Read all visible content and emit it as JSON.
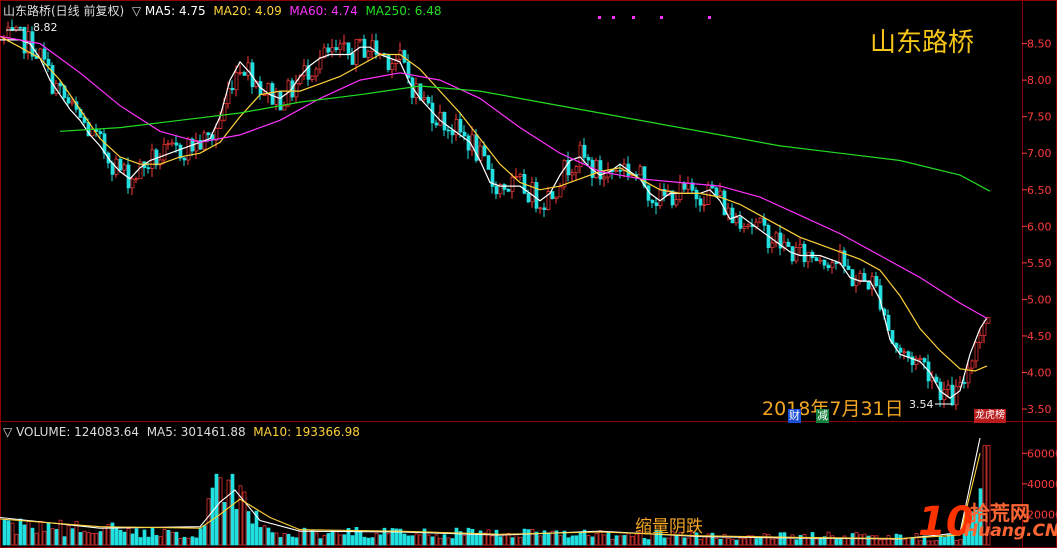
{
  "header": {
    "price_title": "山东路桥(日线 前复权)",
    "ma5_label": "MA5: 4.75",
    "ma20_label": "MA20: 4.09",
    "ma60_label": "MA60: 4.74",
    "ma250_label": "MA250: 6.48",
    "volume_title": "VOLUME: 124083.64",
    "vol_ma5_label": "MA5: 301461.88",
    "vol_ma10_label": "MA10: 193366.98"
  },
  "stock_name": "山东路桥",
  "annotations": {
    "date_label": "2018年7月31日",
    "high_label": "8.82",
    "low_label": "3.54",
    "volume_note": "缩量阴跌",
    "event_markers": [
      "财",
      "减",
      "龙虎榜"
    ]
  },
  "logo": {
    "number": "10",
    "text_top": "拾荒网",
    "text_bottom": "Huang.CN"
  },
  "colors": {
    "up": "#ff3b3b",
    "down": "#22e0e0",
    "ma5": "#ffffff",
    "ma20": "#ffd23a",
    "ma60": "#ff33ff",
    "ma250": "#22dd22",
    "grid": "#8b0000",
    "axis_text": "#ff3b3b"
  },
  "chart_data": [
    {
      "type": "line",
      "title": "山东路桥(日线 前复权)",
      "price_axis_ticks": [
        3.5,
        4.0,
        4.5,
        5.0,
        5.5,
        6.0,
        6.5,
        7.0,
        7.5,
        8.0,
        8.5
      ],
      "ylim": [
        3.35,
        8.85
      ],
      "series": [
        {
          "name": "MA5",
          "x": [
            0,
            10,
            20,
            30,
            40,
            50,
            60,
            70,
            80,
            90,
            100,
            110,
            120,
            130,
            140,
            150,
            160,
            170,
            180,
            190,
            200,
            210,
            220,
            230,
            240,
            250,
            260,
            270,
            280,
            290,
            300,
            310,
            320,
            330,
            340,
            350,
            360,
            370,
            380,
            390,
            400,
            410,
            420,
            430,
            440,
            450,
            460,
            470,
            480,
            490,
            500,
            510,
            520,
            530,
            540,
            550,
            560,
            570,
            580,
            590,
            600,
            610,
            620,
            630,
            640,
            650,
            660,
            670,
            680,
            690,
            700,
            710,
            720,
            730,
            740,
            750,
            760,
            770,
            780,
            790,
            800,
            810,
            820,
            830,
            840,
            850,
            860,
            870,
            880,
            890,
            900,
            910,
            920,
            930,
            940,
            950,
            960,
            970,
            980,
            987
          ],
          "values": [
            8.55,
            8.55,
            8.55,
            8.5,
            8.3,
            8.0,
            7.8,
            7.6,
            7.45,
            7.25,
            7.1,
            6.9,
            6.75,
            6.65,
            6.8,
            6.9,
            6.95,
            7.0,
            7.05,
            7.1,
            7.15,
            7.2,
            7.5,
            8.0,
            8.25,
            8.1,
            7.9,
            7.8,
            7.75,
            7.85,
            8.05,
            8.2,
            8.3,
            8.35,
            8.35,
            8.35,
            8.45,
            8.45,
            8.35,
            8.3,
            8.25,
            7.95,
            7.75,
            7.6,
            7.45,
            7.35,
            7.25,
            7.15,
            6.9,
            6.6,
            6.55,
            6.55,
            6.55,
            6.45,
            6.35,
            6.45,
            6.7,
            6.9,
            6.95,
            6.8,
            6.7,
            6.75,
            6.85,
            6.75,
            6.65,
            6.45,
            6.35,
            6.45,
            6.45,
            6.45,
            6.45,
            6.5,
            6.35,
            6.1,
            6.15,
            6.05,
            5.95,
            5.85,
            5.75,
            5.65,
            5.6,
            5.6,
            5.6,
            5.55,
            5.5,
            5.3,
            5.25,
            5.25,
            5.0,
            4.45,
            4.25,
            4.2,
            4.15,
            4.0,
            3.75,
            3.65,
            3.75,
            4.25,
            4.6,
            4.75
          ]
        },
        {
          "name": "MA20",
          "x": [
            0,
            20,
            40,
            60,
            80,
            100,
            120,
            140,
            160,
            180,
            200,
            220,
            240,
            260,
            280,
            300,
            320,
            340,
            360,
            380,
            400,
            420,
            440,
            460,
            480,
            500,
            520,
            540,
            560,
            580,
            600,
            620,
            640,
            660,
            680,
            700,
            720,
            740,
            760,
            780,
            800,
            820,
            840,
            860,
            880,
            900,
            920,
            940,
            960,
            975,
            987
          ],
          "values": [
            8.6,
            8.45,
            8.3,
            8.0,
            7.6,
            7.2,
            6.95,
            6.85,
            6.85,
            6.95,
            7.0,
            7.15,
            7.5,
            7.8,
            7.85,
            7.85,
            7.95,
            8.05,
            8.2,
            8.35,
            8.35,
            8.15,
            7.85,
            7.55,
            7.2,
            6.85,
            6.6,
            6.5,
            6.55,
            6.65,
            6.75,
            6.8,
            6.65,
            6.5,
            6.45,
            6.45,
            6.4,
            6.3,
            6.15,
            6.0,
            5.85,
            5.75,
            5.65,
            5.55,
            5.4,
            5.05,
            4.6,
            4.3,
            4.05,
            4.02,
            4.09
          ]
        },
        {
          "name": "MA60",
          "x": [
            0,
            40,
            80,
            120,
            160,
            200,
            240,
            280,
            320,
            360,
            400,
            440,
            480,
            520,
            560,
            600,
            640,
            680,
            720,
            760,
            800,
            840,
            880,
            920,
            960,
            987
          ],
          "values": [
            8.6,
            8.5,
            8.1,
            7.65,
            7.3,
            7.15,
            7.25,
            7.45,
            7.75,
            8.0,
            8.1,
            8.0,
            7.75,
            7.35,
            7.0,
            6.75,
            6.65,
            6.6,
            6.55,
            6.4,
            6.15,
            5.9,
            5.6,
            5.3,
            4.95,
            4.74
          ]
        },
        {
          "name": "MA250",
          "x": [
            60,
            120,
            180,
            240,
            300,
            360,
            420,
            480,
            540,
            600,
            660,
            720,
            780,
            840,
            900,
            960,
            990
          ],
          "values": [
            7.3,
            7.35,
            7.45,
            7.55,
            7.7,
            7.8,
            7.92,
            7.85,
            7.7,
            7.55,
            7.4,
            7.25,
            7.1,
            7.0,
            6.9,
            6.7,
            6.48
          ]
        }
      ]
    },
    {
      "type": "bar",
      "title": "VOLUME: 124083.64",
      "volume_axis_ticks": [
        20000,
        40000,
        60000
      ],
      "ylim": [
        0,
        70000
      ],
      "spikes": [
        {
          "x": 220,
          "value": 44000
        },
        {
          "x": 985,
          "value": 65000
        },
        {
          "x": 990,
          "value": 45000
        }
      ],
      "series": [
        {
          "name": "MA5",
          "x": [
            0,
            100,
            200,
            220,
            235,
            260,
            300,
            400,
            500,
            600,
            700,
            800,
            900,
            960,
            980,
            987
          ],
          "values": [
            18000,
            11000,
            12000,
            28000,
            36000,
            16000,
            9000,
            8500,
            6500,
            9000,
            5500,
            4500,
            4000,
            8000,
            90000,
            301461.88
          ]
        },
        {
          "name": "MA10",
          "x": [
            0,
            100,
            200,
            220,
            240,
            270,
            300,
            400,
            500,
            600,
            700,
            800,
            900,
            960,
            980,
            987
          ],
          "values": [
            17000,
            12000,
            11000,
            20000,
            30000,
            18000,
            10000,
            9000,
            7000,
            8500,
            6000,
            5000,
            4200,
            6500,
            60000,
            193366.98
          ]
        }
      ]
    }
  ]
}
